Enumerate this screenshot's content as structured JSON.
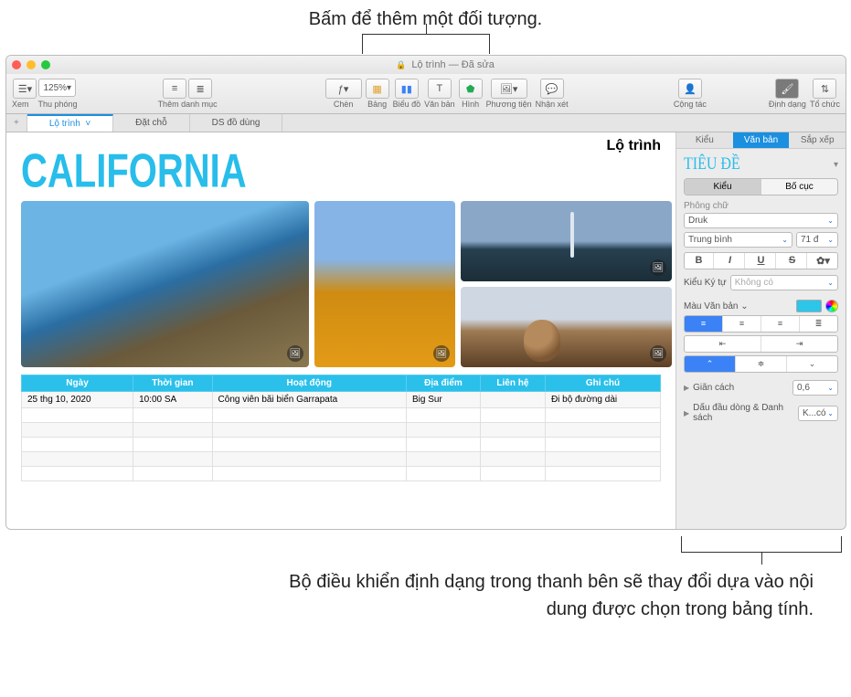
{
  "callouts": {
    "top": "Bấm để thêm một đối tượng.",
    "bottom": "Bộ điều khiển định dạng trong thanh bên sẽ thay đổi dựa vào nội dung được chọn trong bảng tính."
  },
  "window": {
    "title_doc": "Lộ trình",
    "title_state": "Đã sửa"
  },
  "toolbar": {
    "view": "Xem",
    "zoom_value": "125%",
    "zoom_label": "Thu phóng",
    "add_category": "Thêm danh mục",
    "insert": "Chèn",
    "table": "Bảng",
    "chart": "Biểu đồ",
    "text": "Văn bản",
    "shape": "Hình",
    "media": "Phương tiện",
    "comment": "Nhận xét",
    "collab": "Cộng tác",
    "format": "Định dạng",
    "organize": "Tổ chức"
  },
  "sheets": [
    "Lộ trình",
    "Đặt chỗ",
    "DS đồ dùng"
  ],
  "doc": {
    "heading": "CALIFORNIA",
    "subtitle": "Lộ trình"
  },
  "table": {
    "headers": [
      "Ngày",
      "Thời gian",
      "Hoạt động",
      "Địa điểm",
      "Liên hệ",
      "Ghi chú"
    ],
    "rows": [
      {
        "c": [
          "25 thg 10, 2020",
          "10:00 SA",
          "Công viên bãi biển Garrapata",
          "Big Sur",
          "",
          "Đi bộ đường dài"
        ]
      }
    ]
  },
  "sidebar": {
    "tabs": [
      "Kiểu",
      "Văn bản",
      "Sắp xếp"
    ],
    "title": "TIÊU ĐỀ",
    "seg": [
      "Kiểu",
      "Bố cục"
    ],
    "font_section": "Phông chữ",
    "font_family": "Druk",
    "font_weight": "Trung bình",
    "font_size": "71 đ",
    "bold": "B",
    "italic": "I",
    "underline": "U",
    "strike": "S",
    "char_style_label": "Kiểu Ký tự",
    "char_style_value": "Không có",
    "text_color_label": "Màu Văn bản",
    "spacing_label": "Giãn cách",
    "spacing_value": "0,6",
    "bullets_label": "Dấu đầu dòng & Danh sách",
    "bullets_value": "K...có"
  }
}
